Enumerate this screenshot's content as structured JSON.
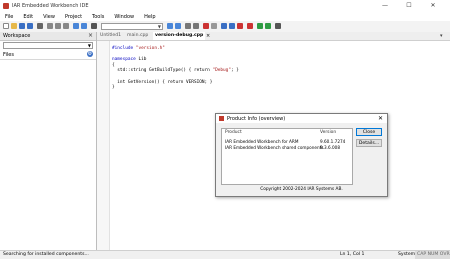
{
  "window": {
    "title": "IAR Embedded Workbench IDE",
    "minimize": "—",
    "maximize": "☐",
    "close": "✕"
  },
  "menu": [
    "File",
    "Edit",
    "View",
    "Project",
    "Tools",
    "Window",
    "Help"
  ],
  "toolbar": {
    "find_value": ""
  },
  "workspace": {
    "header": "Workspace",
    "close": "×",
    "dropdown_value": "",
    "files_label": "Files",
    "gear_glyph": "⚙"
  },
  "editor": {
    "tabs": [
      {
        "label": "Untitled1",
        "active": false
      },
      {
        "label": "main.cpp",
        "active": false
      },
      {
        "label": "version-debug.cpp",
        "active": true
      }
    ],
    "tab_close": "×",
    "tab_overflow": "▾",
    "code_lines": [
      {
        "kw": "#include",
        "rest": " ",
        "str": "\"version.h\"",
        "tail": ""
      },
      {
        "kw": "",
        "rest": "",
        "str": "",
        "tail": ""
      },
      {
        "kw": "namespace",
        "rest": " Lib",
        "str": "",
        "tail": ""
      },
      {
        "kw": "",
        "rest": "{",
        "str": "",
        "tail": ""
      },
      {
        "kw": "",
        "rest": "  std::string GetBuildType() { return ",
        "str": "\"Debug\"",
        "tail": "; }"
      },
      {
        "kw": "",
        "rest": "",
        "str": "",
        "tail": ""
      },
      {
        "kw": "",
        "rest": "  int GetVersion() { return VERSION; }",
        "str": "",
        "tail": ""
      },
      {
        "kw": "",
        "rest": "}",
        "str": "",
        "tail": ""
      }
    ]
  },
  "dialog": {
    "title": "Product Info (overview)",
    "close": "✕",
    "columns": [
      "Product",
      "Version"
    ],
    "rows": [
      {
        "product": "IAR Embedded Workbench for ARM",
        "version": "9.60.1.7274"
      },
      {
        "product": "IAR Embedded Workbench shared components",
        "version": "9.3.6.008"
      }
    ],
    "close_button": "Close",
    "details_button": "Details...",
    "copyright": "Copyright 2002-2024 IAR Systems AB."
  },
  "status": {
    "left": "Searching for installed components...",
    "position": "Ln 1, Col 1",
    "system": "System",
    "caps": "CAP NUM OVR"
  },
  "colors": {
    "keyword": "#0000c0",
    "string": "#a31515",
    "accent": "#0078d7"
  }
}
